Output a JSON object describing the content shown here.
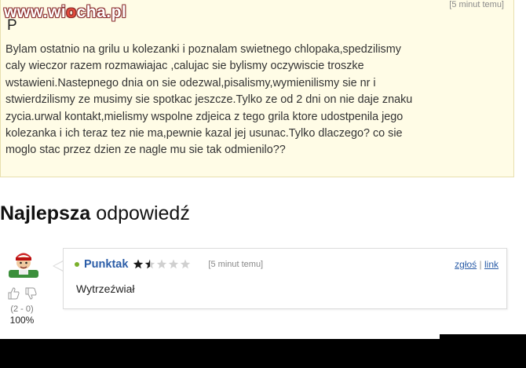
{
  "watermark": {
    "before": "www.wi",
    "dot": "o",
    "after": "cha.pl"
  },
  "question": {
    "title_fragment": "P",
    "time": "[5 minut temu]",
    "lines": [
      "Bylam ostatnio na grilu u kolezanki i poznalam swietnego chlopaka,spedzilismy",
      "caly wieczor razem rozmawiajac ,calujac sie bylismy oczywiscie troszke",
      "wstawieni.Nastepnego dnia on sie odezwal,pisalismy,wymienilismy sie nr i",
      "stwierdzilismy ze musimy sie spotkac jeszcze.Tylko ze od 2 dni on nie daje znaku",
      "zycia.urwal kontakt,mielismy wspolne zdjeica z tego grila ktore udostpenila jego",
      "kolezanka i ich teraz tez nie ma,pewnie kazal jej usunac.Tylko dlaczego? co sie",
      "moglo stac przez dzien ze nagle mu sie tak odmienilo??"
    ]
  },
  "best_answer": {
    "heading_bold": "Najlepsza",
    "heading_rest": "odpowiedź",
    "user": "Punktak",
    "rating_stars": 1.5,
    "rating_max": 5,
    "time": "[5 minut temu]",
    "report_link": "zgłoś",
    "separator": "|",
    "link_label": "link",
    "body": "Wytrzeźwiał",
    "votes_count": "(2 - 0)",
    "votes_percent": "100%"
  },
  "colors": {
    "question_bg": "#fffce6",
    "link": "#2b5da8",
    "star": "#1a1a1a",
    "star_empty": "#d0d0d0",
    "online_dot": "#7ab02c"
  }
}
